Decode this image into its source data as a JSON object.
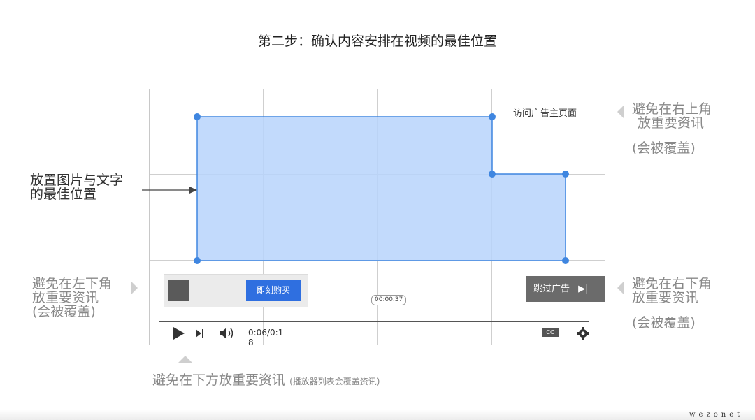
{
  "title": "第二步：确认内容安排在视频的最佳位置",
  "video": {
    "ad_link": "访问广告主页面",
    "buy_label": "即刻购买",
    "timestamp": "00:00.37",
    "skip_label": "跳过广告",
    "time_line1": "0:06/0:1",
    "time_line2": "8",
    "cc_label": "CC"
  },
  "annotations": {
    "place_content_line1": "放置图片与文字",
    "place_content_line2": "的最佳位置",
    "avoid_top_right_line1": "避免在右上角",
    "avoid_top_right_line2": "放重要资讯",
    "avoid_top_right_line3": "(会被覆盖)",
    "avoid_bottom_left_line1": "避免在左下角",
    "avoid_bottom_left_line2": "放重要资讯",
    "avoid_bottom_left_line3": "(会被覆盖)",
    "avoid_bottom_right_line1": "避免在右下角",
    "avoid_bottom_right_line2": "放重要资讯",
    "avoid_bottom_right_line3": "(会被覆盖)",
    "avoid_bottom_main": "避免在下方放重要资讯",
    "avoid_bottom_small": "(播放器列表会覆盖资讯)"
  },
  "logo": "wezonet",
  "colors": {
    "safe_area_fill": "#b7d3fb",
    "safe_area_stroke": "#3f86e0",
    "buy_button": "#2f6fe0",
    "skip_button": "#6b6b6b"
  }
}
